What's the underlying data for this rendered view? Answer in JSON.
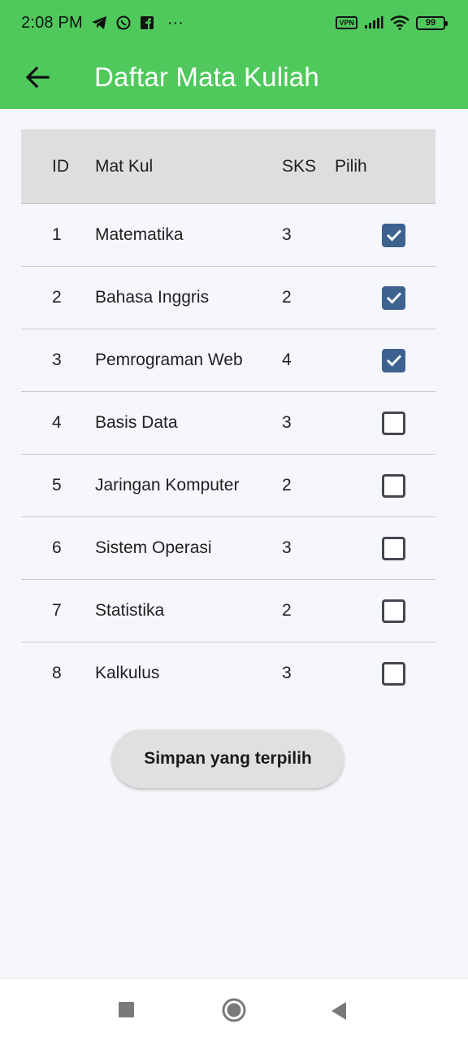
{
  "status_bar": {
    "time": "2:08 PM",
    "more": "···",
    "vpn": "VPN",
    "battery": "99"
  },
  "app_bar": {
    "title": "Daftar Mata Kuliah",
    "back_icon": "arrow-left-icon"
  },
  "table": {
    "headers": [
      "ID",
      "Mat Kul",
      "SKS",
      "Pilih"
    ],
    "rows": [
      {
        "id": "1",
        "name": "Matematika",
        "sks": "3",
        "selected": true
      },
      {
        "id": "2",
        "name": "Bahasa Inggris",
        "sks": "2",
        "selected": true
      },
      {
        "id": "3",
        "name": "Pemrograman Web",
        "sks": "4",
        "selected": true
      },
      {
        "id": "4",
        "name": "Basis Data",
        "sks": "3",
        "selected": false
      },
      {
        "id": "5",
        "name": "Jaringan Komputer",
        "sks": "2",
        "selected": false
      },
      {
        "id": "6",
        "name": "Sistem Operasi",
        "sks": "3",
        "selected": false
      },
      {
        "id": "7",
        "name": "Statistika",
        "sks": "2",
        "selected": false
      },
      {
        "id": "8",
        "name": "Kalkulus",
        "sks": "3",
        "selected": false
      }
    ]
  },
  "save_button": {
    "label": "Simpan yang terpilih"
  },
  "colors": {
    "app_bar": "#4fc95b",
    "checkbox_checked": "#3d6290",
    "header_bg": "#dedede",
    "page_bg": "#f6f7fc"
  }
}
